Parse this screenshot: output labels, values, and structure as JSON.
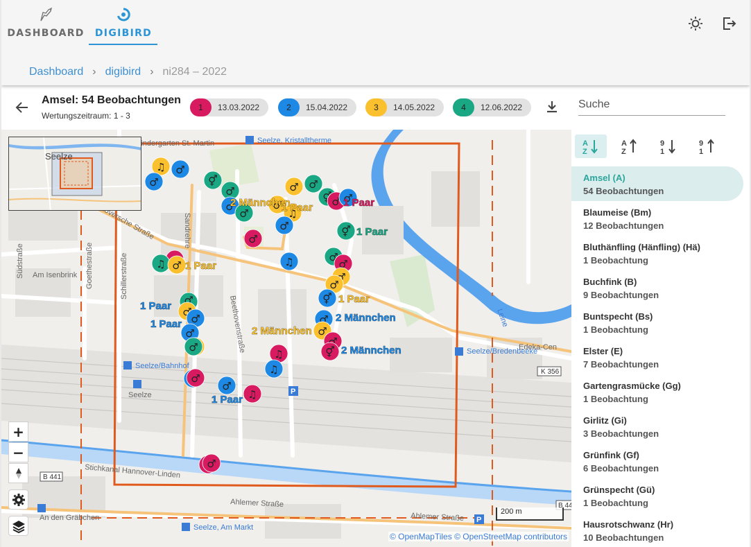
{
  "header": {
    "tabs": [
      {
        "label": "DASHBOARD",
        "icon": "bird-icon"
      },
      {
        "label": "DIGIBIRD",
        "icon": "digibird-logo-icon"
      }
    ],
    "icons": [
      "brightness-icon",
      "logout-icon"
    ]
  },
  "breadcrumb": {
    "items": [
      "Dashboard",
      "digibird"
    ],
    "current": "ni284 – 2022"
  },
  "toolbar": {
    "title": "Amsel: 54 Beobachtungen",
    "subtitle": "Wertungszeitraum: 1 - 3",
    "visits": [
      {
        "num": "1",
        "date": "13.03.2022",
        "color": "#d81b60"
      },
      {
        "num": "2",
        "date": "15.04.2022",
        "color": "#1e88e5"
      },
      {
        "num": "3",
        "date": "14.05.2022",
        "color": "#fbc02d"
      },
      {
        "num": "4",
        "date": "12.06.2022",
        "color": "#1aa784"
      }
    ],
    "search_placeholder": "Suche"
  },
  "map": {
    "attribution": "© OpenMapTiles © OpenStreetMap contributors",
    "scale": "200 m",
    "zoom_in": "+",
    "zoom_out": "−",
    "minimap_label": "Seelze",
    "streets": [
      "Kindergarten St. Martin",
      "Hannoversche Straße",
      "Sandrehre",
      "Am Isenbrink",
      "Südstraße",
      "Goethestraße",
      "Schillerstraße",
      "Beethovenstraße",
      "Stichkanal Hannover-Linden",
      "Ahlemer Straße",
      "An den Gräbchen",
      "Leine",
      "K 356",
      "B 441",
      "Edeka-Cen"
    ],
    "stops": [
      "Seelze, Kristalltherme",
      "Seelze/Bahnhof",
      "Seelze",
      "Seelze/Bredenbeeke",
      "Seelze, Am Markt"
    ],
    "labels": [
      {
        "text": "2 Männchen",
        "color": "#fbc02d"
      },
      {
        "text": "1 Paar",
        "color": "#fbc02d"
      },
      {
        "text": "1 Paar",
        "color": "#d81b60"
      },
      {
        "text": "1 Paar",
        "color": "#1aa784"
      },
      {
        "text": "1 Paar",
        "color": "#fbc02d"
      },
      {
        "text": "1 Paar",
        "color": "#1e88e5"
      },
      {
        "text": "1 Paar",
        "color": "#1e88e5"
      },
      {
        "text": "1 Paar",
        "color": "#fbc02d"
      },
      {
        "text": "2 Männchen",
        "color": "#1e88e5"
      },
      {
        "text": "2 Männchen",
        "color": "#fbc02d"
      },
      {
        "text": "2 Männchen",
        "color": "#1e88e5"
      },
      {
        "text": "1 Paar",
        "color": "#1e88e5"
      }
    ]
  },
  "sidebar": {
    "sort_icons": [
      "sort-alpha-asc-icon",
      "sort-alpha-desc-icon",
      "sort-count-asc-icon",
      "sort-count-desc-icon"
    ],
    "sort_labels": [
      [
        "A",
        "Z"
      ],
      [
        "Z",
        "A"
      ],
      [
        "9",
        "1"
      ],
      [
        "1",
        "9"
      ]
    ],
    "items": [
      {
        "name": "Amsel (A)",
        "count": "54 Beobachtungen"
      },
      {
        "name": "Blaumeise (Bm)",
        "count": "12 Beobachtungen"
      },
      {
        "name": "Bluthänfling (Hänfling) (Hä)",
        "count": "1 Beobachtung"
      },
      {
        "name": "Buchfink (B)",
        "count": "9 Beobachtungen"
      },
      {
        "name": "Buntspecht (Bs)",
        "count": "1 Beobachtung"
      },
      {
        "name": "Elster (E)",
        "count": "7 Beobachtungen"
      },
      {
        "name": "Gartengrasmücke (Gg)",
        "count": "1 Beobachtung"
      },
      {
        "name": "Girlitz (Gi)",
        "count": "3 Beobachtungen"
      },
      {
        "name": "Grünfink (Gf)",
        "count": "6 Beobachtungen"
      },
      {
        "name": "Grünspecht (Gü)",
        "count": "1 Beobachtung"
      },
      {
        "name": "Hausrotschwanz (Hr)",
        "count": "10 Beobachtungen"
      }
    ]
  }
}
